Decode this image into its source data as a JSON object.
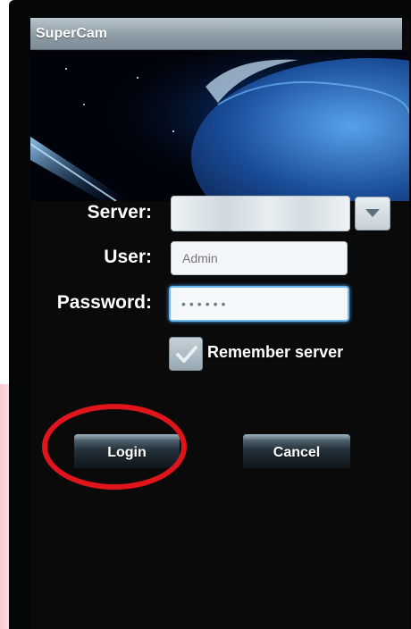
{
  "app": {
    "title": "SuperCam"
  },
  "form": {
    "server": {
      "label": "Server:",
      "value": ""
    },
    "user": {
      "label": "User:",
      "placeholder": "Admin"
    },
    "password": {
      "label": "Password:",
      "value": "••••••"
    },
    "remember": {
      "label": "Remember server",
      "checked": true
    }
  },
  "actions": {
    "login_label": "Login",
    "cancel_label": "Cancel"
  },
  "icons": {
    "dropdown": "chevron-down-icon",
    "checkbox": "check-icon",
    "banner": "earth-in-space-image"
  },
  "colors": {
    "annotation": "#e0141b",
    "focus": "#49a6ec",
    "titlebar": "#8c9ba4"
  }
}
